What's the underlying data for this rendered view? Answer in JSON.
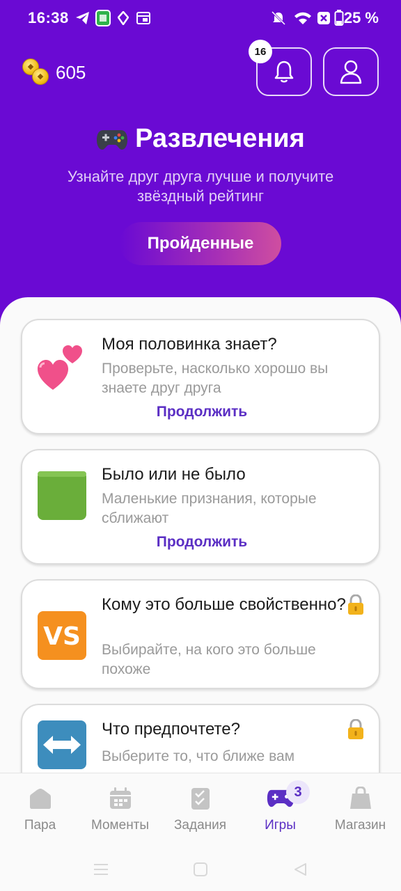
{
  "status_bar": {
    "time": "16:38",
    "battery": "25 %",
    "icons": [
      "telegram-icon",
      "app-icon",
      "location-icon",
      "calendar-icon",
      "mute-icon",
      "wifi-icon",
      "close-box-icon",
      "battery-icon"
    ]
  },
  "header": {
    "coins": "605",
    "notifications_count": "16",
    "title": "Развлечения",
    "title_emoji": "gamepad-icon",
    "subtitle": "Узнайте друг друга лучше и получите звёздный рейтинг",
    "completed_button": "Пройденные"
  },
  "games": [
    {
      "emoji": "two-hearts-icon",
      "title": "Моя половинка знает?",
      "description": "Проверьте, насколько хорошо вы знаете друг друга",
      "cta": "Продолжить",
      "locked": false
    },
    {
      "emoji": "green-square-icon",
      "title": "Было или не было",
      "description": "Маленькие признания, которые сближают",
      "cta": "Продолжить",
      "locked": false
    },
    {
      "emoji": "vs-icon",
      "title": "Кому это больше свойственно?",
      "description": "Выбирайте, на кого это больше похоже",
      "locked": true
    },
    {
      "emoji": "left-right-arrow-icon",
      "title": "Что предпочтете?",
      "description": "Выберите то, что ближе вам",
      "locked": true
    }
  ],
  "tabbar": {
    "tabs": [
      {
        "label": "Пара",
        "icon": "home-icon"
      },
      {
        "label": "Моменты",
        "icon": "calendar-icon"
      },
      {
        "label": "Задания",
        "icon": "checklist-icon"
      },
      {
        "label": "Игры",
        "icon": "gamepad-icon",
        "badge": "3",
        "active": true
      },
      {
        "label": "Магазин",
        "icon": "shopping-bag-icon"
      }
    ]
  },
  "colors": {
    "header_bg": "#6a0ad3",
    "accent": "#5b2fc4",
    "content_bg": "#fafafa"
  }
}
